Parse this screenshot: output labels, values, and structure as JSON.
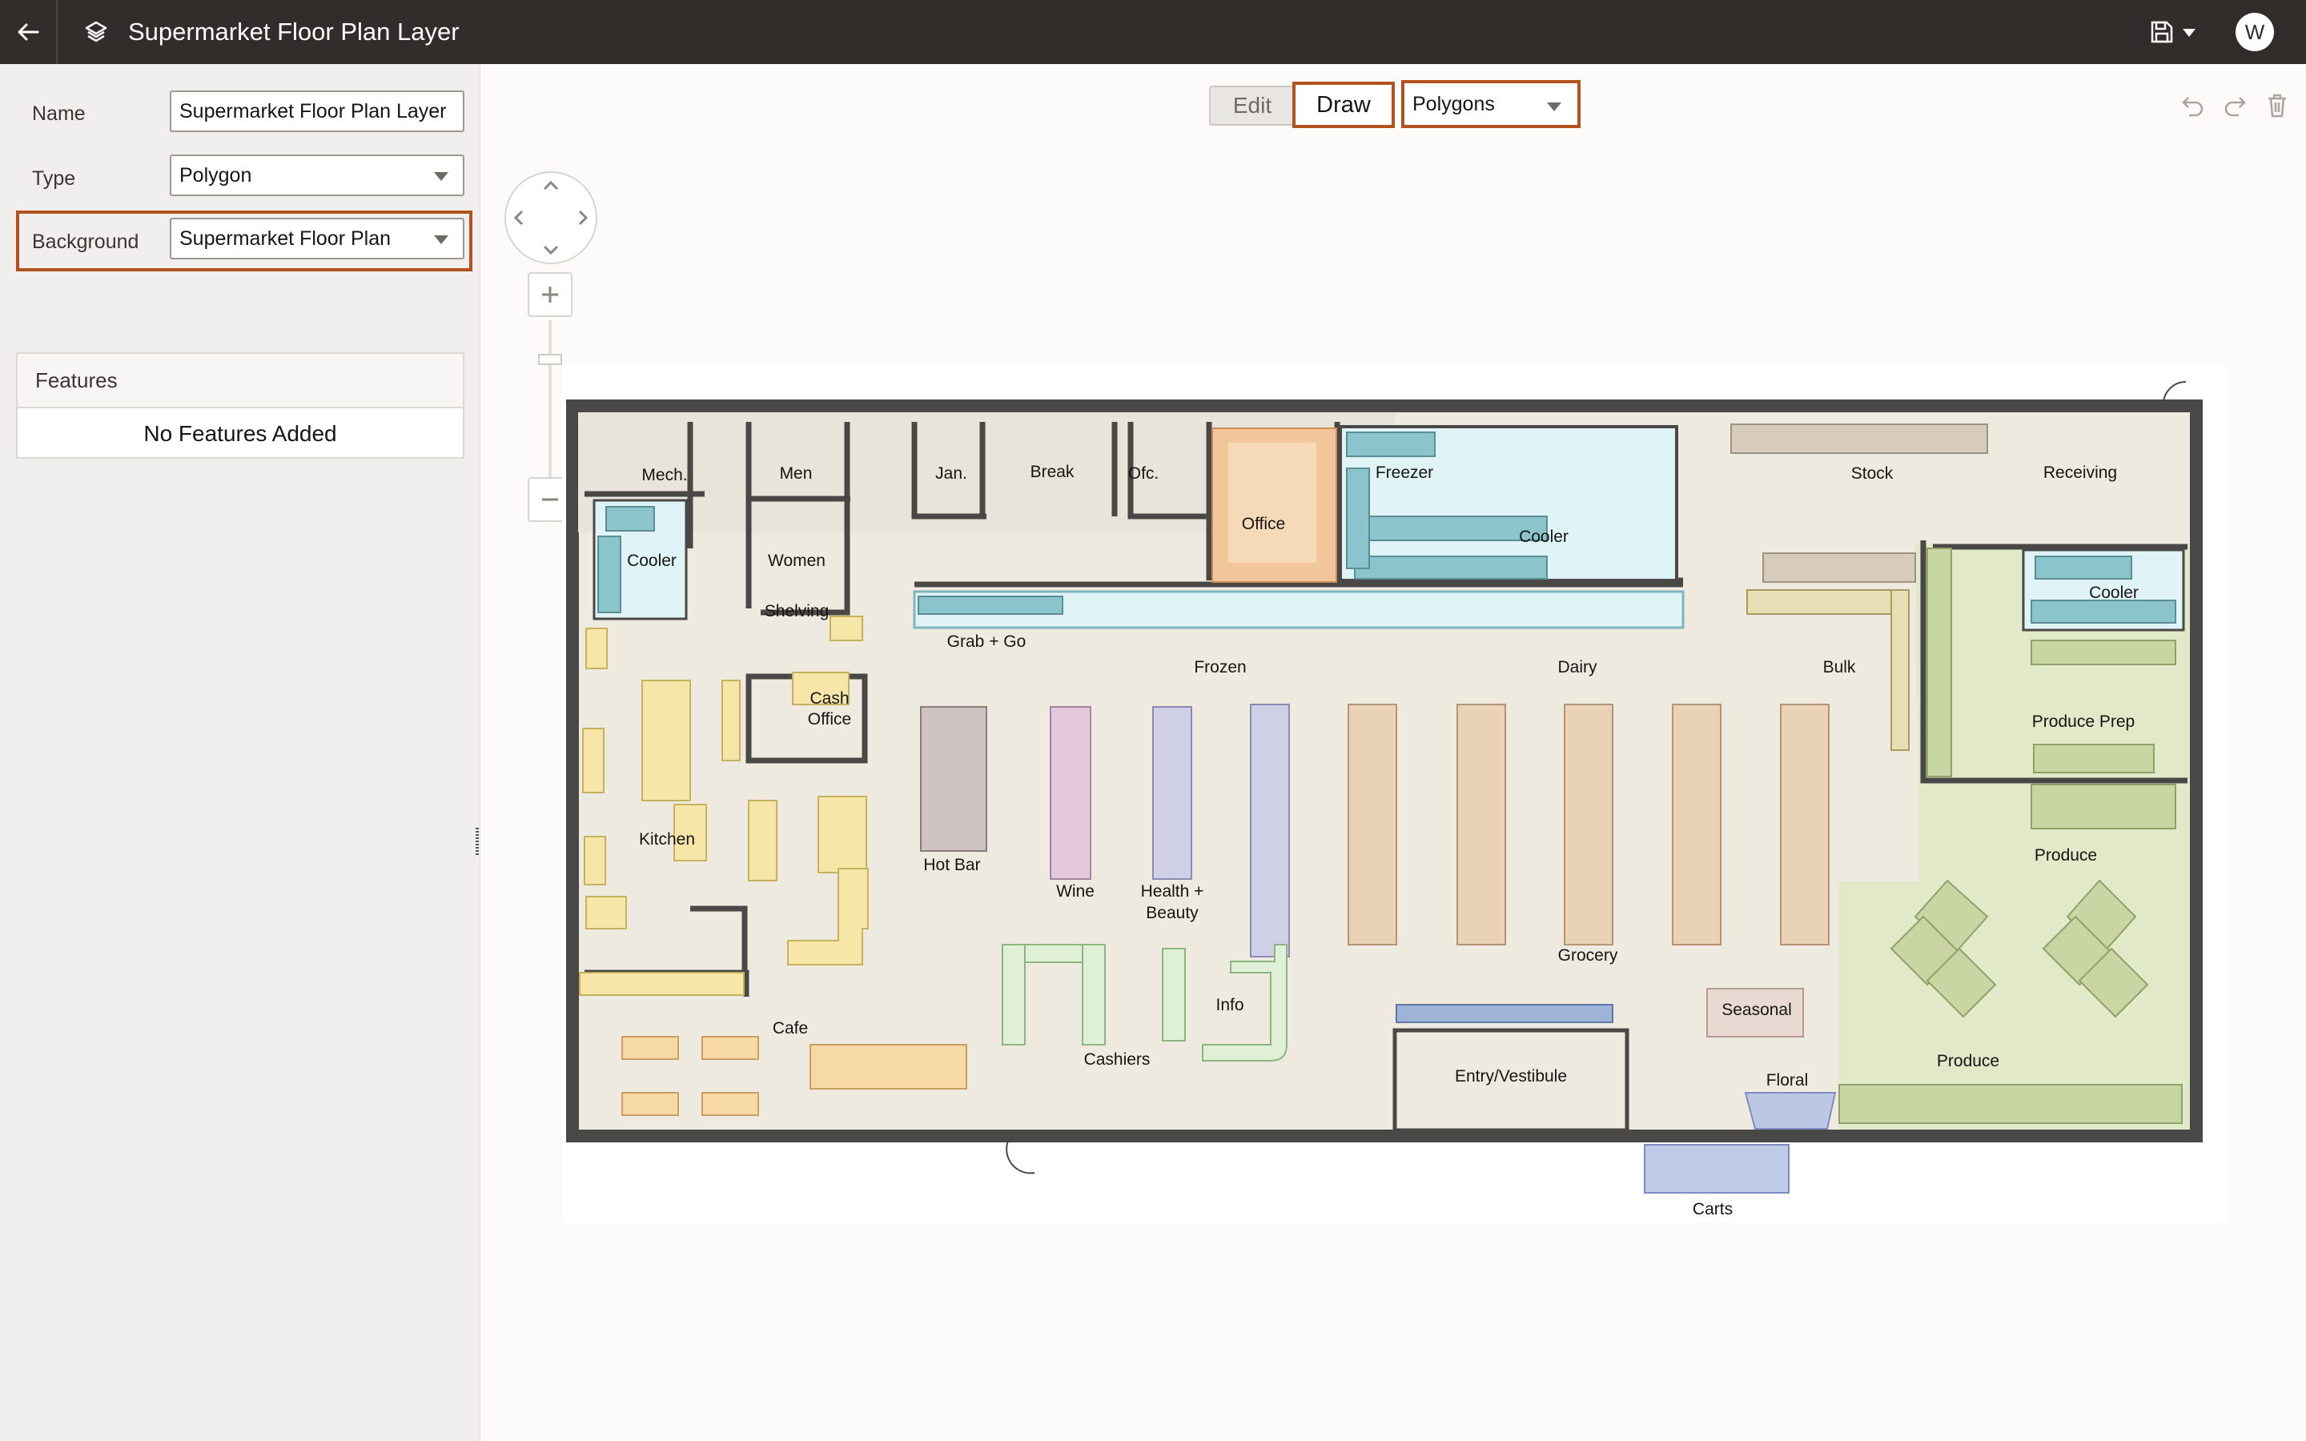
{
  "header": {
    "title": "Supermarket Floor Plan Layer",
    "avatar_initial": "W"
  },
  "form": {
    "name_label": "Name",
    "name_value": "Supermarket Floor Plan Layer",
    "type_label": "Type",
    "type_value": "Polygon",
    "background_label": "Background",
    "background_value": "Supermarket Floor Plan"
  },
  "features": {
    "header": "Features",
    "empty_message": "No Features Added"
  },
  "toolbar": {
    "edit_label": "Edit",
    "draw_label": "Draw",
    "shape_value": "Polygons"
  },
  "floorplan": {
    "labels": {
      "mech": "Mech.",
      "men": "Men",
      "jan": "Jan.",
      "break": "Break",
      "ofc": "Ofc.",
      "office": "Office",
      "freezer": "Freezer",
      "cooler_main": "Cooler",
      "stock": "Stock",
      "receiving": "Receiving",
      "cooler_left": "Cooler",
      "women": "Women",
      "shelving": "Shelving",
      "grab_go": "Grab + Go",
      "frozen": "Frozen",
      "dairy": "Dairy",
      "bulk": "Bulk",
      "cooler_right": "Cooler",
      "cash_office_1": "Cash",
      "cash_office_2": "Office",
      "produce_prep": "Produce Prep",
      "kitchen": "Kitchen",
      "hot_bar": "Hot Bar",
      "wine": "Wine",
      "health_1": "Health +",
      "health_2": "Beauty",
      "produce_1": "Produce",
      "grocery": "Grocery",
      "info": "Info",
      "seasonal": "Seasonal",
      "cafe": "Cafe",
      "cashiers": "Cashiers",
      "entry": "Entry/Vestibule",
      "produce_2": "Produce",
      "floral": "Floral",
      "carts": "Carts"
    }
  },
  "colors": {
    "topbar": "#312d2a",
    "accent_outline": "#b1521f",
    "panel_bg": "#f1efed",
    "wall": "#4a4846",
    "floor": "#eeeae0",
    "produce_area": "#e2e9c9",
    "cooler_fill": "#e0f3f6"
  }
}
